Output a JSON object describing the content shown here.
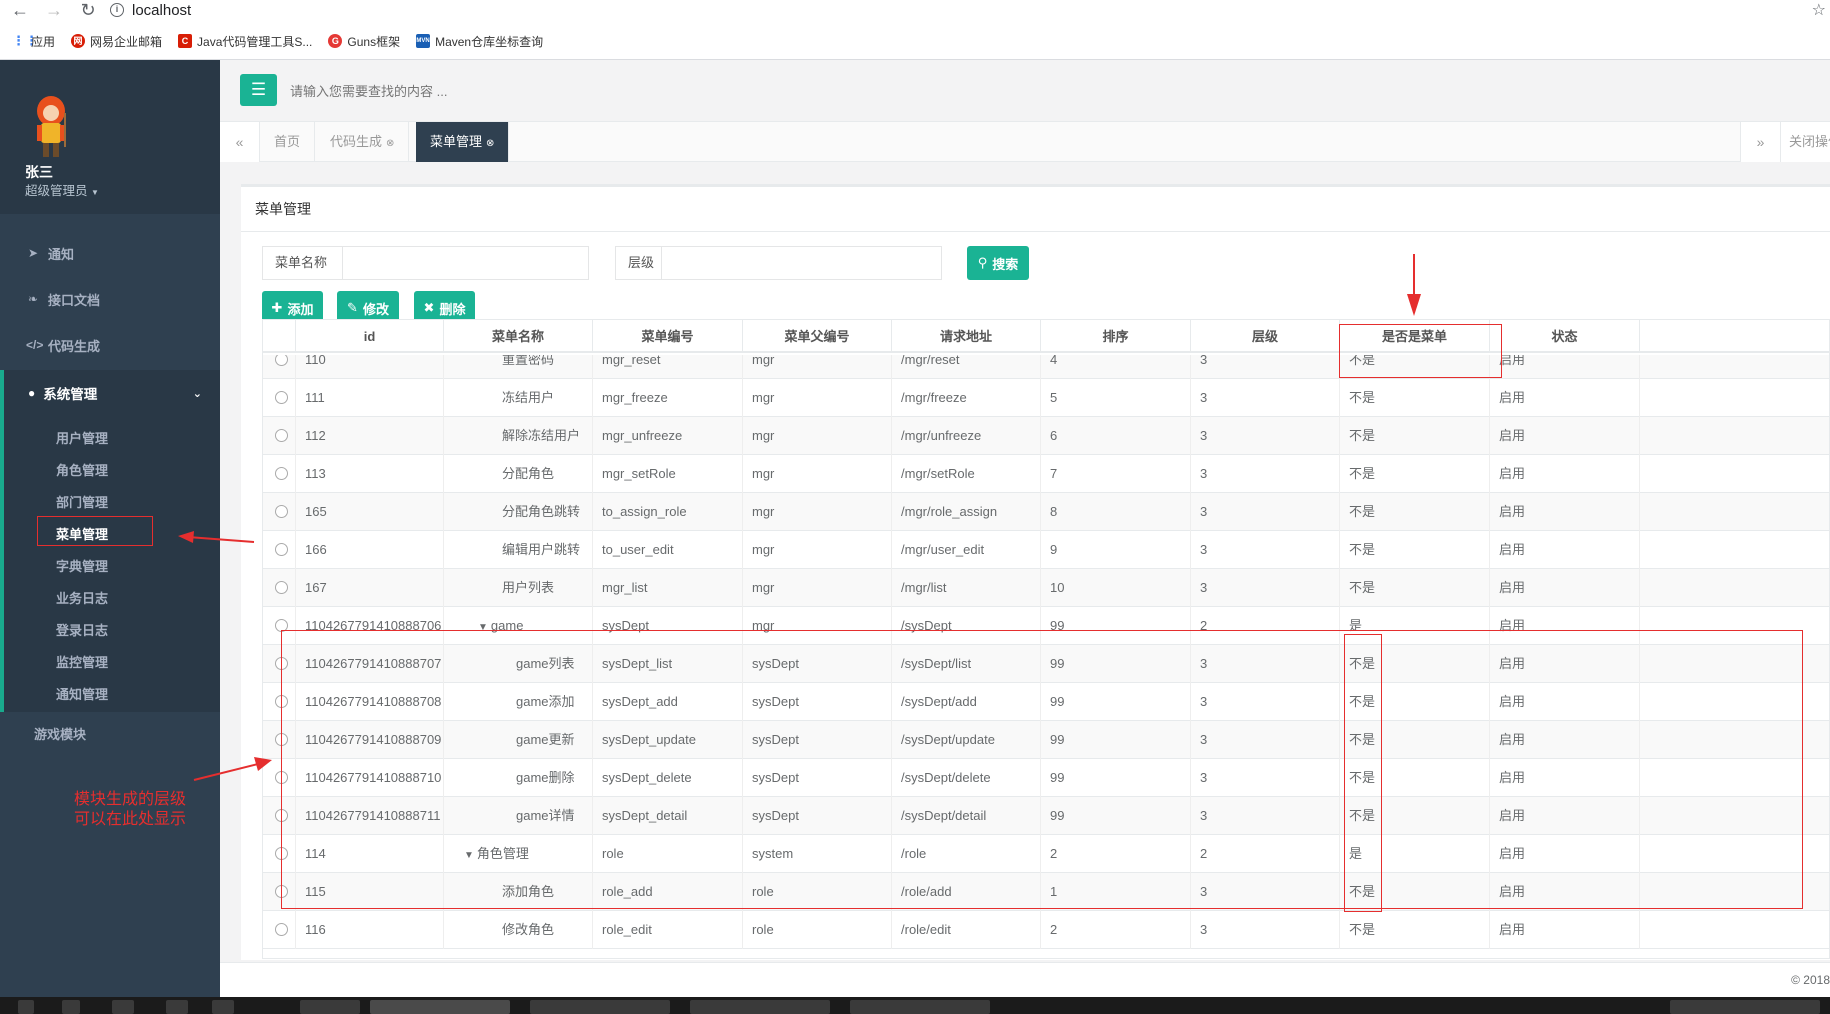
{
  "browser": {
    "url": "localhost",
    "bookmarks": [
      {
        "label": "应用",
        "icon": "apps-grid-icon",
        "color": "#4285f4"
      },
      {
        "label": "网易企业邮箱",
        "icon": "netease-mail-icon",
        "color": "#d81e06"
      },
      {
        "label": "Java代码管理工具S...",
        "icon": "java-tool-icon",
        "color": "#d81e06"
      },
      {
        "label": "Guns框架",
        "icon": "guns-icon",
        "color": "#e53935"
      },
      {
        "label": "Maven仓库坐标查询",
        "icon": "maven-icon",
        "color": "#1a5fb4"
      }
    ]
  },
  "sidebar": {
    "user": {
      "name": "张三",
      "role": "超级管理员"
    },
    "items": [
      {
        "label": "通知",
        "icon": "paper-plane-icon"
      },
      {
        "label": "接口文档",
        "icon": "leaf-icon"
      },
      {
        "label": "代码生成",
        "icon": "code-icon"
      }
    ],
    "system_group": {
      "label": "系统管理",
      "icon": "user-icon",
      "sub_items": [
        "用户管理",
        "角色管理",
        "部门管理",
        "菜单管理",
        "字典管理",
        "业务日志",
        "登录日志",
        "监控管理",
        "通知管理"
      ],
      "active": "菜单管理"
    },
    "game_module": "游戏模块"
  },
  "topbar": {
    "search_placeholder": "请输入您需要查找的内容 ..."
  },
  "tabs": {
    "items": [
      {
        "label": "首页",
        "closable": false
      },
      {
        "label": "代码生成",
        "closable": true
      },
      {
        "label": "菜单管理",
        "closable": true,
        "active": true
      }
    ],
    "close_ops": "关闭操作"
  },
  "panel": {
    "title": "菜单管理",
    "filters": [
      {
        "label": "菜单名称",
        "value": ""
      },
      {
        "label": "层级",
        "value": ""
      }
    ],
    "buttons": {
      "search": "搜索",
      "add": "添加",
      "edit": "修改",
      "delete": "删除"
    }
  },
  "table": {
    "columns": [
      "id",
      "菜单名称",
      "菜单编号",
      "菜单父编号",
      "请求地址",
      "排序",
      "层级",
      "是否是菜单",
      "状态"
    ],
    "rows": [
      {
        "id": "110",
        "name": "重置密码",
        "code": "mgr_reset",
        "pcode": "mgr",
        "url": "/mgr/reset",
        "num": "4",
        "levels": "3",
        "ismenu": "不是",
        "status": "启用",
        "indent": 0,
        "expander": false
      },
      {
        "id": "111",
        "name": "冻结用户",
        "code": "mgr_freeze",
        "pcode": "mgr",
        "url": "/mgr/freeze",
        "num": "5",
        "levels": "3",
        "ismenu": "不是",
        "status": "启用",
        "indent": 0,
        "expander": false
      },
      {
        "id": "112",
        "name": "解除冻结用户",
        "code": "mgr_unfreeze",
        "pcode": "mgr",
        "url": "/mgr/unfreeze",
        "num": "6",
        "levels": "3",
        "ismenu": "不是",
        "status": "启用",
        "indent": 0,
        "expander": false
      },
      {
        "id": "113",
        "name": "分配角色",
        "code": "mgr_setRole",
        "pcode": "mgr",
        "url": "/mgr/setRole",
        "num": "7",
        "levels": "3",
        "ismenu": "不是",
        "status": "启用",
        "indent": 0,
        "expander": false
      },
      {
        "id": "165",
        "name": "分配角色跳转",
        "code": "to_assign_role",
        "pcode": "mgr",
        "url": "/mgr/role_assign",
        "num": "8",
        "levels": "3",
        "ismenu": "不是",
        "status": "启用",
        "indent": 0,
        "expander": false
      },
      {
        "id": "166",
        "name": "编辑用户跳转",
        "code": "to_user_edit",
        "pcode": "mgr",
        "url": "/mgr/user_edit",
        "num": "9",
        "levels": "3",
        "ismenu": "不是",
        "status": "启用",
        "indent": 0,
        "expander": false
      },
      {
        "id": "167",
        "name": "用户列表",
        "code": "mgr_list",
        "pcode": "mgr",
        "url": "/mgr/list",
        "num": "10",
        "levels": "3",
        "ismenu": "不是",
        "status": "启用",
        "indent": 0,
        "expander": false
      },
      {
        "id": "1104267791410888706",
        "name": "game",
        "code": "sysDept",
        "pcode": "mgr",
        "url": "/sysDept",
        "num": "99",
        "levels": "2",
        "ismenu": "是",
        "status": "启用",
        "indent": 1,
        "expander": true
      },
      {
        "id": "1104267791410888707",
        "name": "game列表",
        "code": "sysDept_list",
        "pcode": "sysDept",
        "url": "/sysDept/list",
        "num": "99",
        "levels": "3",
        "ismenu": "不是",
        "status": "启用",
        "indent": 2,
        "expander": false
      },
      {
        "id": "1104267791410888708",
        "name": "game添加",
        "code": "sysDept_add",
        "pcode": "sysDept",
        "url": "/sysDept/add",
        "num": "99",
        "levels": "3",
        "ismenu": "不是",
        "status": "启用",
        "indent": 2,
        "expander": false
      },
      {
        "id": "1104267791410888709",
        "name": "game更新",
        "code": "sysDept_update",
        "pcode": "sysDept",
        "url": "/sysDept/update",
        "num": "99",
        "levels": "3",
        "ismenu": "不是",
        "status": "启用",
        "indent": 2,
        "expander": false
      },
      {
        "id": "1104267791410888710",
        "name": "game删除",
        "code": "sysDept_delete",
        "pcode": "sysDept",
        "url": "/sysDept/delete",
        "num": "99",
        "levels": "3",
        "ismenu": "不是",
        "status": "启用",
        "indent": 2,
        "expander": false
      },
      {
        "id": "1104267791410888711",
        "name": "game详情",
        "code": "sysDept_detail",
        "pcode": "sysDept",
        "url": "/sysDept/detail",
        "num": "99",
        "levels": "3",
        "ismenu": "不是",
        "status": "启用",
        "indent": 2,
        "expander": false
      },
      {
        "id": "114",
        "name": "角色管理",
        "code": "role",
        "pcode": "system",
        "url": "/role",
        "num": "2",
        "levels": "2",
        "ismenu": "是",
        "status": "启用",
        "indent": 1,
        "expander": true
      },
      {
        "id": "115",
        "name": "添加角色",
        "code": "role_add",
        "pcode": "role",
        "url": "/role/add",
        "num": "1",
        "levels": "3",
        "ismenu": "不是",
        "status": "启用",
        "indent": 0,
        "expander": false
      },
      {
        "id": "116",
        "name": "修改角色",
        "code": "role_edit",
        "pcode": "role",
        "url": "/role/edit",
        "num": "2",
        "levels": "3",
        "ismenu": "不是",
        "status": "启用",
        "indent": 0,
        "expander": false
      }
    ]
  },
  "footer": "© 2018",
  "annotations": {
    "note_line1": "模块生成的层级",
    "note_line2": "可以在此处显示",
    "color": "#e52e2e"
  },
  "colors": {
    "accent": "#1ab394",
    "sidebar": "#2f4050",
    "sidebar_dark": "#293846"
  }
}
